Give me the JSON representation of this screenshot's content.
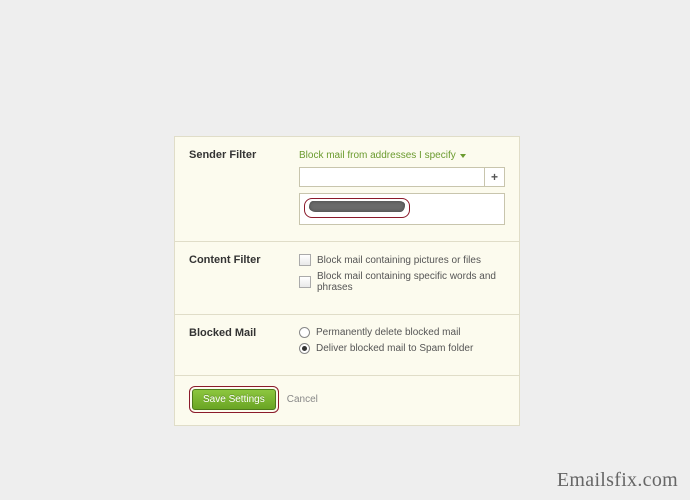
{
  "senderFilter": {
    "label": "Sender Filter",
    "dropdown": "Block mail from addresses I specify",
    "inputValue": "",
    "listItem": "[redacted]"
  },
  "contentFilter": {
    "label": "Content Filter",
    "option1": "Block mail containing pictures or files",
    "option2": "Block mail containing specific words and phrases"
  },
  "blockedMail": {
    "label": "Blocked Mail",
    "option1": "Permanently delete blocked mail",
    "option2": "Deliver blocked mail to Spam folder",
    "selected": 2
  },
  "footer": {
    "save": "Save Settings",
    "cancel": "Cancel"
  },
  "watermark": "Emailsfix.com"
}
